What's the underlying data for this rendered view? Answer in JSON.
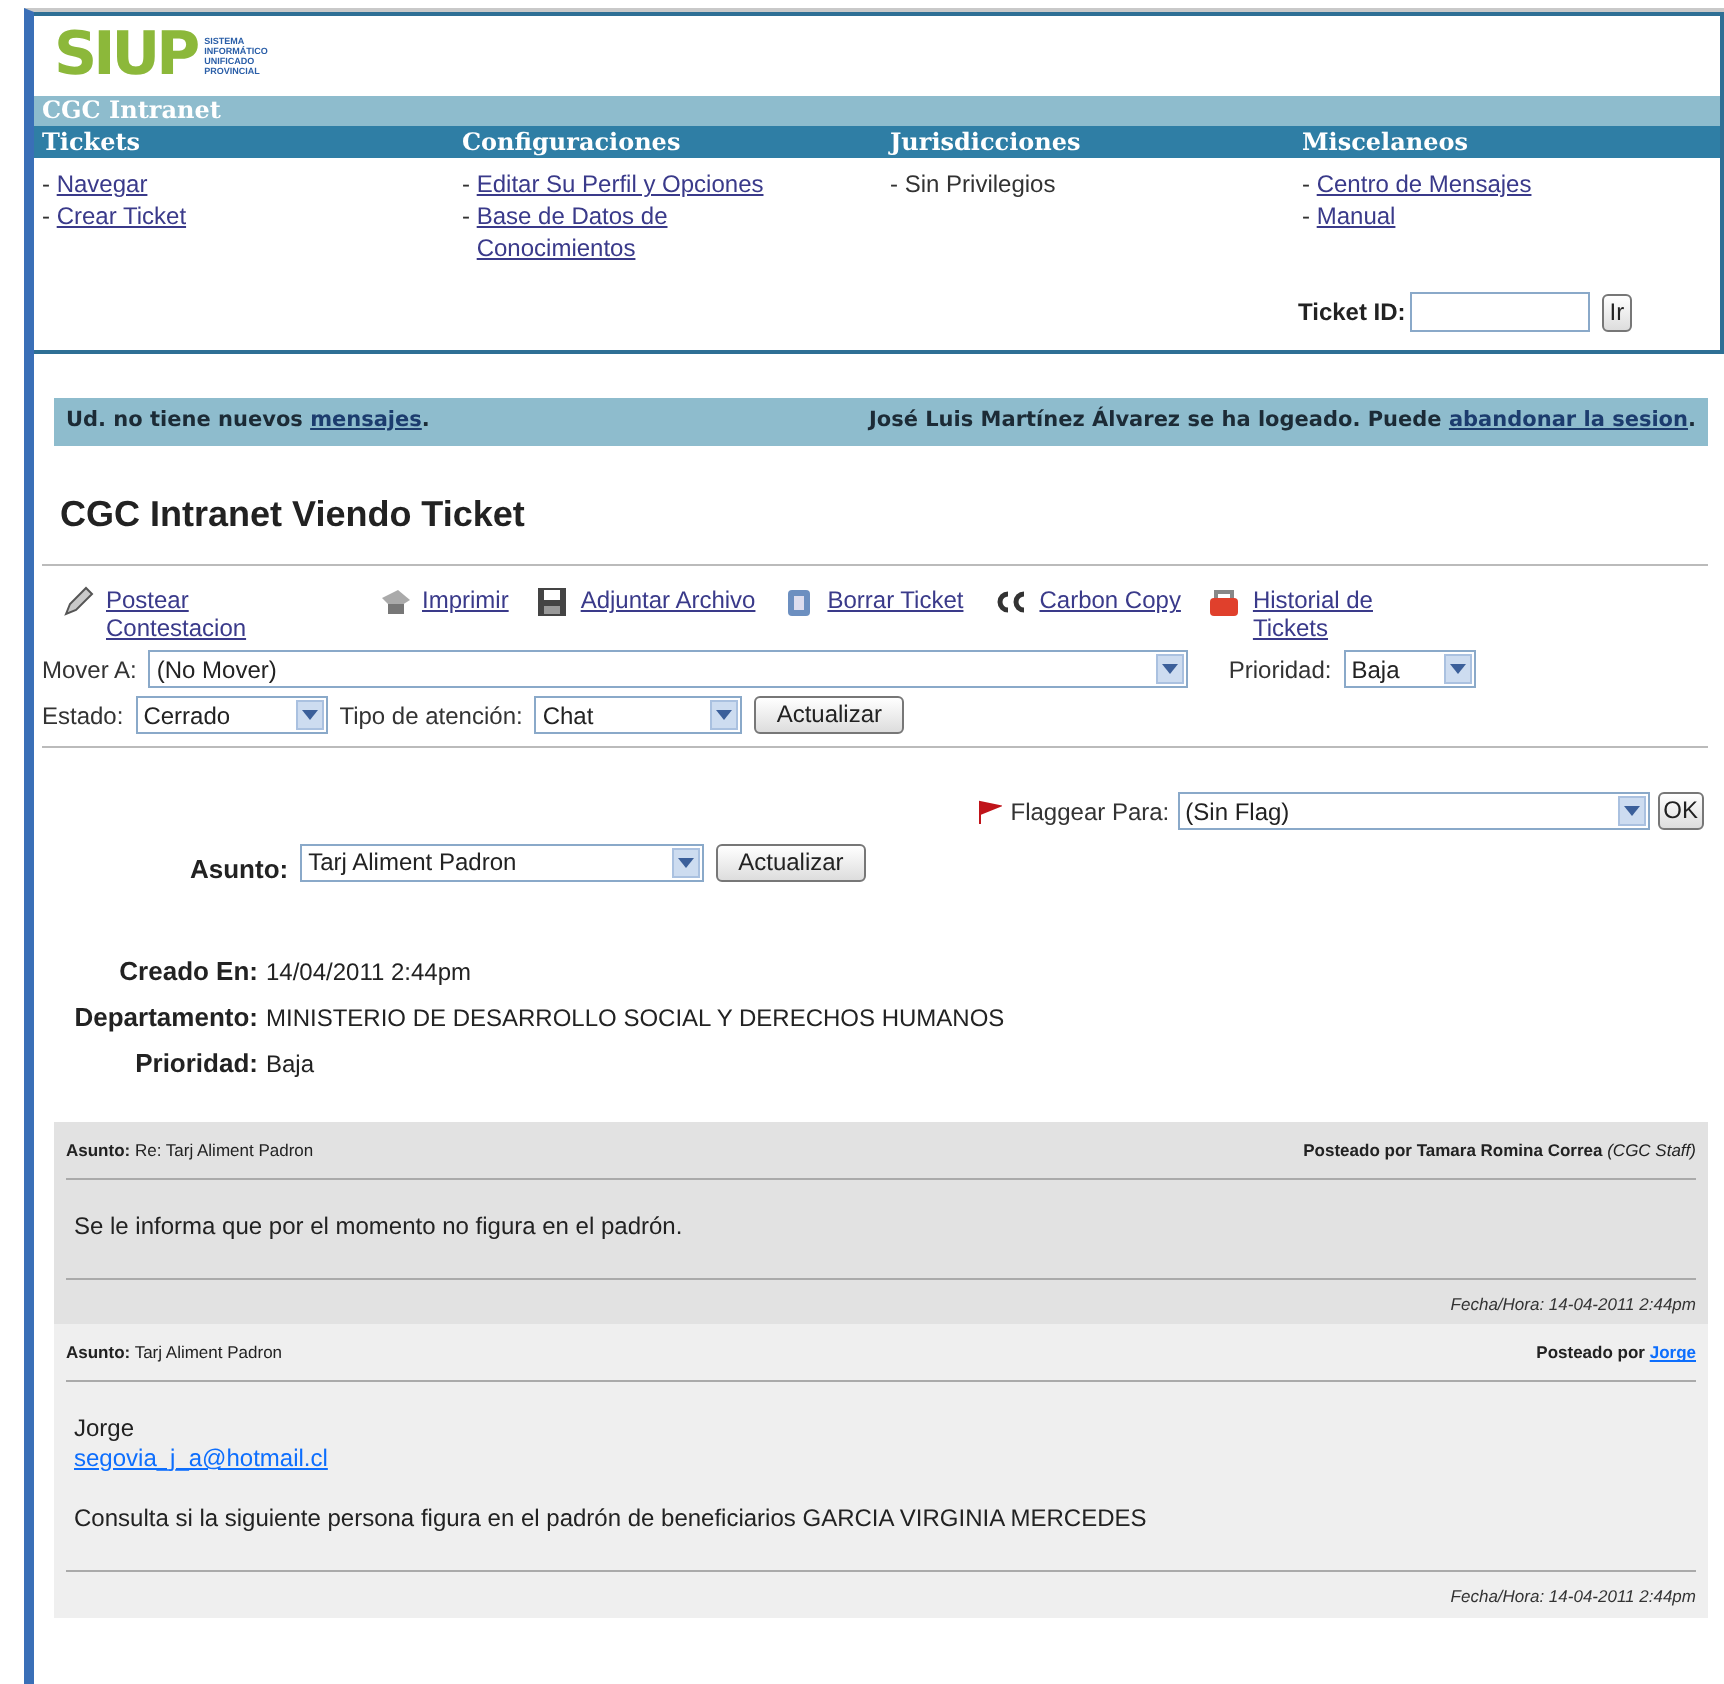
{
  "logo": {
    "name": "SIUP",
    "tagline": [
      "SISTEMA",
      "INFORMÁTICO",
      "UNIFICADO",
      "PROVINCIAL"
    ]
  },
  "app_title": "CGC Intranet",
  "menu": [
    {
      "heading": "Tickets",
      "items": [
        {
          "bullet": "-",
          "label": "Navegar",
          "kind": "link"
        },
        {
          "bullet": "-",
          "label": "Crear Ticket",
          "kind": "link"
        }
      ]
    },
    {
      "heading": "Configuraciones",
      "items": [
        {
          "bullet": "-",
          "label": "Editar Su Perfil y Opciones",
          "kind": "link"
        },
        {
          "bullet": "-",
          "label": "Base de Datos de Conocimientos",
          "kind": "link"
        }
      ]
    },
    {
      "heading": "Jurisdicciones",
      "items": [
        {
          "bullet": "-",
          "label": "Sin Privilegios",
          "kind": "text"
        }
      ]
    },
    {
      "heading": "Miscelaneos",
      "items": [
        {
          "bullet": "-",
          "label": "Centro de Mensajes",
          "kind": "link"
        },
        {
          "bullet": "-",
          "label": "Manual",
          "kind": "link"
        }
      ]
    }
  ],
  "ticket_id": {
    "label": "Ticket ID:",
    "button": "Ir"
  },
  "notice": {
    "left": {
      "text": "Ud. no tiene nuevos",
      "link": "mensajes",
      "end": "."
    },
    "right": {
      "text": "José Luis Martínez Álvarez se ha logeado. Puede",
      "link": "abandonar la sesion",
      "end": "."
    }
  },
  "page_title": "CGC Intranet Viendo Ticket",
  "toolbar": [
    {
      "label": "Postear Contestacion",
      "kind": "pencil"
    },
    {
      "label": "Imprimir",
      "kind": "printer"
    },
    {
      "label": "Adjuntar Archivo",
      "kind": "disk"
    },
    {
      "label": "Borrar Ticket",
      "kind": "trash"
    },
    {
      "label": "Carbon Copy",
      "kind": "cc"
    },
    {
      "label": "Historial de Tickets",
      "kind": "history"
    }
  ],
  "move": {
    "label": "Mover A:",
    "value": "(No Mover)"
  },
  "priority": {
    "label": "Prioridad:",
    "value": "Baja"
  },
  "status": {
    "label": "Estado:",
    "value": "Cerrado"
  },
  "attention": {
    "label": "Tipo de atención:",
    "value": "Chat"
  },
  "update_button": "Actualizar",
  "flag": {
    "label": "Flaggear Para:",
    "value": "(Sin Flag)",
    "button": "OK"
  },
  "subject": {
    "label": "Asunto:",
    "value": "Tarj Aliment Padron",
    "button": "Actualizar"
  },
  "details": [
    {
      "label": "Creado En:",
      "value": "14/04/2011 2:44pm"
    },
    {
      "label": "Departamento:",
      "value": "MINISTERIO DE DESARROLLO SOCIAL Y DERECHOS HUMANOS"
    },
    {
      "label": "Prioridad:",
      "value": "Baja"
    }
  ],
  "posts": [
    {
      "subject_label": "Asunto:",
      "subject": "Re: Tarj Aliment Padron",
      "posted_by": "Posteado por",
      "author": "Tamara Romina Correa",
      "author_is_link": false,
      "role": "(CGC Staff)",
      "staff": true,
      "body": [
        {
          "kind": "text",
          "text": "Se le informa que por el momento no figura en el padrón."
        }
      ],
      "date_label": "Fecha/Hora:",
      "date": "14-04-2011 2:44pm"
    },
    {
      "subject_label": "Asunto:",
      "subject": "Tarj Aliment Padron",
      "posted_by": "Posteado por",
      "author": "Jorge",
      "author_is_link": true,
      "staff": false,
      "body": [
        {
          "kind": "text",
          "text": "Jorge"
        },
        {
          "kind": "link",
          "text": "segovia_j_a@hotmail.cl"
        },
        {
          "kind": "paragraph",
          "text": "Consulta si la siguiente persona figura en el padrón de beneficiarios GARCIA VIRGINIA MERCEDES"
        }
      ],
      "date_label": "Fecha/Hora:",
      "date": "14-04-2011 2:44pm"
    }
  ]
}
